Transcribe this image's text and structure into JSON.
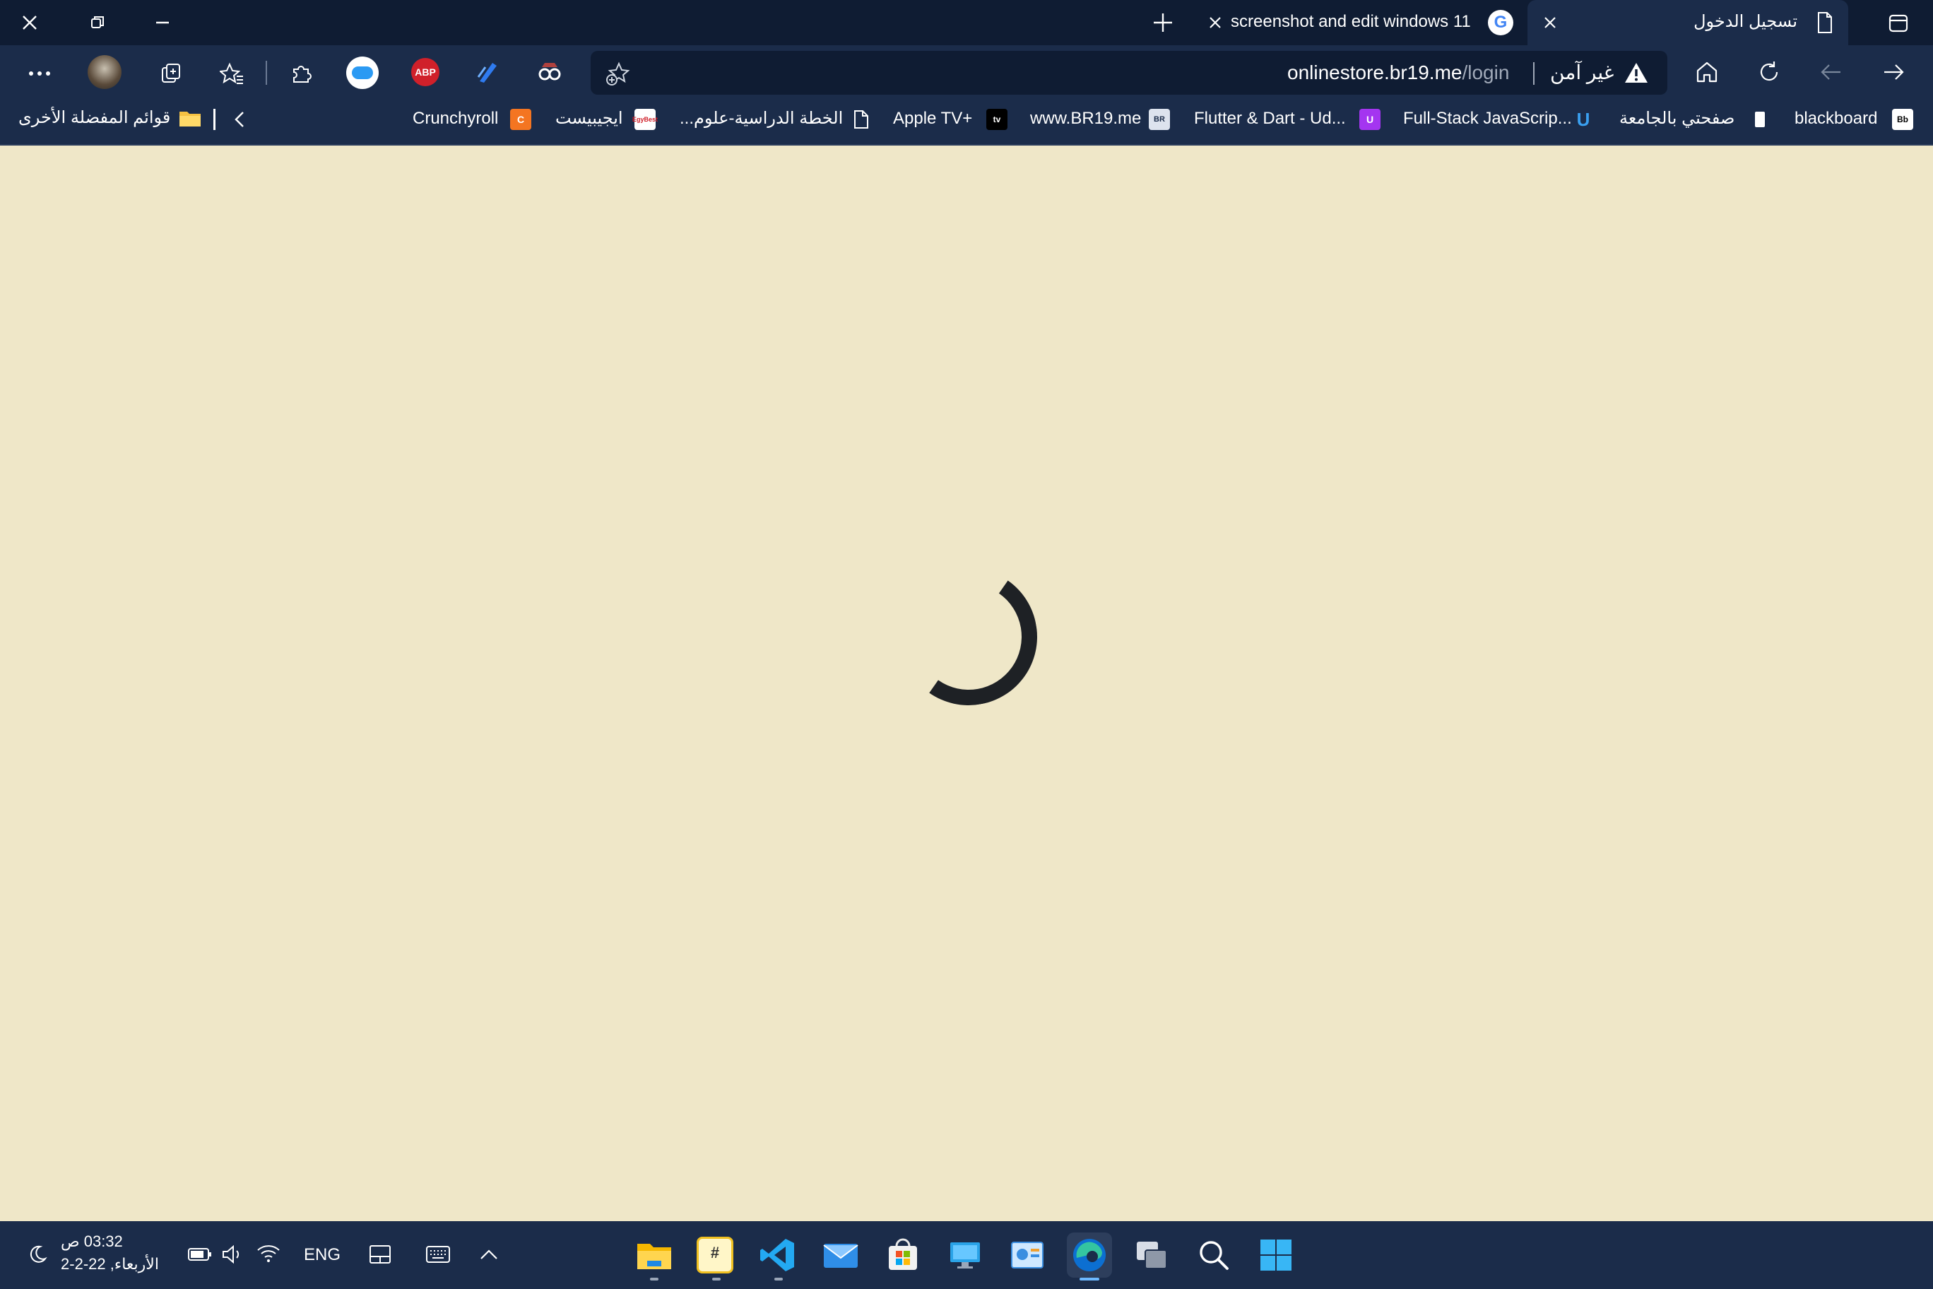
{
  "window": {
    "tabs": [
      {
        "label": "تسجيل الدخول",
        "active": true
      },
      {
        "label": "screenshot and edit windows 11",
        "active": false
      }
    ]
  },
  "address_bar": {
    "security_label": "غير آمن",
    "url_host": "onlinestore.br19.me",
    "url_path": "/login"
  },
  "favorites": {
    "items": [
      {
        "label": "blackboard",
        "icon": "blackboard-icon"
      },
      {
        "label": "صفحتي بالجامعة",
        "icon": "document-icon"
      },
      {
        "label": "Full-Stack JavaScrip...",
        "icon": "udemy-icon"
      },
      {
        "label": "Flutter & Dart - Ud...",
        "icon": "udemy-purple-icon"
      },
      {
        "label": "www.BR19.me",
        "icon": "br19-icon"
      },
      {
        "label": "Apple TV+",
        "icon": "appletv-icon"
      },
      {
        "label": "الخطة الدراسية-علوم...",
        "icon": "page-icon"
      },
      {
        "label": "ايجيبيست",
        "icon": "egybest-icon"
      },
      {
        "label": "Crunchyroll",
        "icon": "crunchyroll-icon"
      }
    ],
    "other_favorites": "قوائم المفضلة الأخرى"
  },
  "taskbar": {
    "time": "03:32 ص",
    "date": "الأربعاء, 22-2-2",
    "language": "ENG"
  },
  "colors": {
    "page_background": "#efe7c8",
    "titlebar": "#0f1c33",
    "toolbar": "#1b2c4a",
    "spinner": "#1e2125"
  }
}
